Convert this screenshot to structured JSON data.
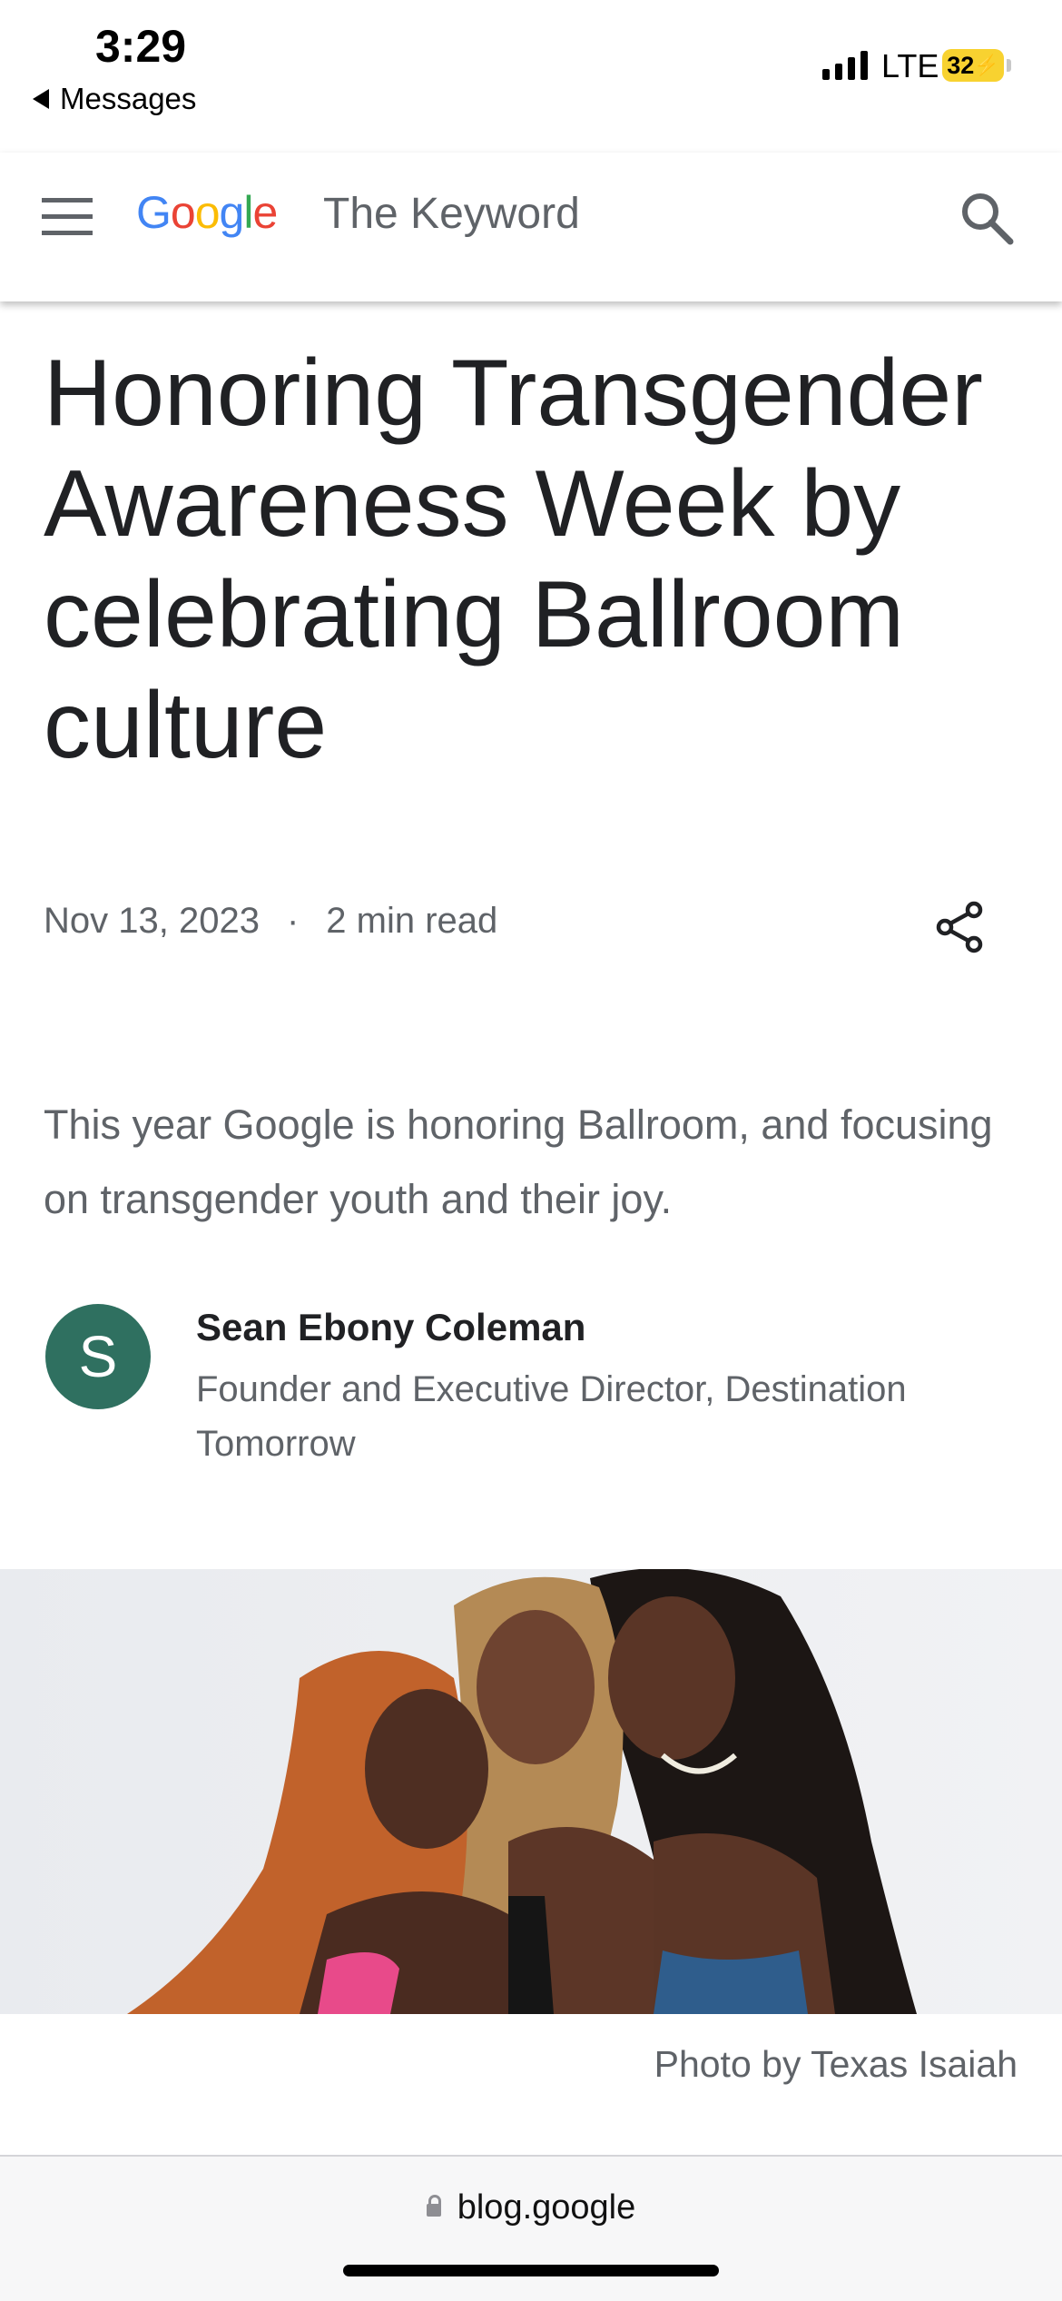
{
  "status_bar": {
    "time": "3:29",
    "back_app": "Messages",
    "network": "LTE",
    "battery": "32"
  },
  "header": {
    "logo_letters": [
      {
        "char": "G",
        "color": "#4285F4"
      },
      {
        "char": "o",
        "color": "#EA4335"
      },
      {
        "char": "o",
        "color": "#FBBC05"
      },
      {
        "char": "g",
        "color": "#4285F4"
      },
      {
        "char": "l",
        "color": "#34A853"
      },
      {
        "char": "e",
        "color": "#EA4335"
      }
    ],
    "site_name": "The Keyword",
    "menu_icon": "hamburger-menu-icon",
    "search_icon": "search-icon"
  },
  "article": {
    "title": "Honoring Transgender Awareness Week by celebrating Ballroom culture",
    "date": "Nov 13, 2023",
    "separator": "·",
    "read_time": "2 min read",
    "share_icon": "share-icon",
    "subtitle": "This year Google is honoring Ballroom, and focusing on transgender youth and their joy.",
    "author": {
      "initial": "S",
      "avatar_color": "#2f7060",
      "name": "Sean Ebony Coleman",
      "title": "Founder and Executive Director, Destination Tomorrow"
    },
    "photo_caption": "Photo by Texas Isaiah"
  },
  "browser": {
    "url": "blog.google"
  }
}
